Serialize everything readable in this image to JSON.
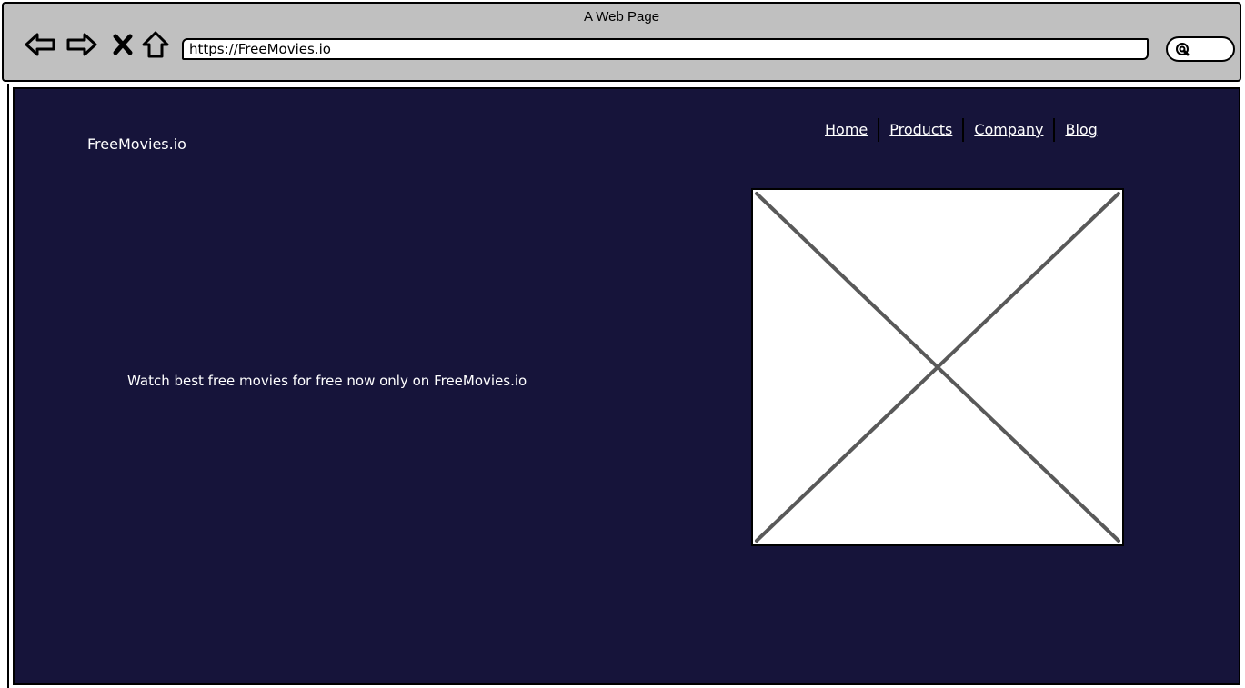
{
  "window": {
    "title": "A Web Page"
  },
  "toolbar": {
    "back_icon": "back-arrow-icon",
    "forward_icon": "forward-arrow-icon",
    "stop_icon": "close-icon",
    "home_icon": "home-icon",
    "search_icon": "search-icon"
  },
  "address_bar": {
    "url": "https://FreeMovies.io"
  },
  "page": {
    "background": "#16143a",
    "logo": "FreeMovies.io",
    "nav": [
      {
        "label": "Home"
      },
      {
        "label": "Products"
      },
      {
        "label": "Company"
      },
      {
        "label": "Blog"
      }
    ],
    "hero_text": "Watch best free movies for free now only on FreeMovies.io"
  }
}
